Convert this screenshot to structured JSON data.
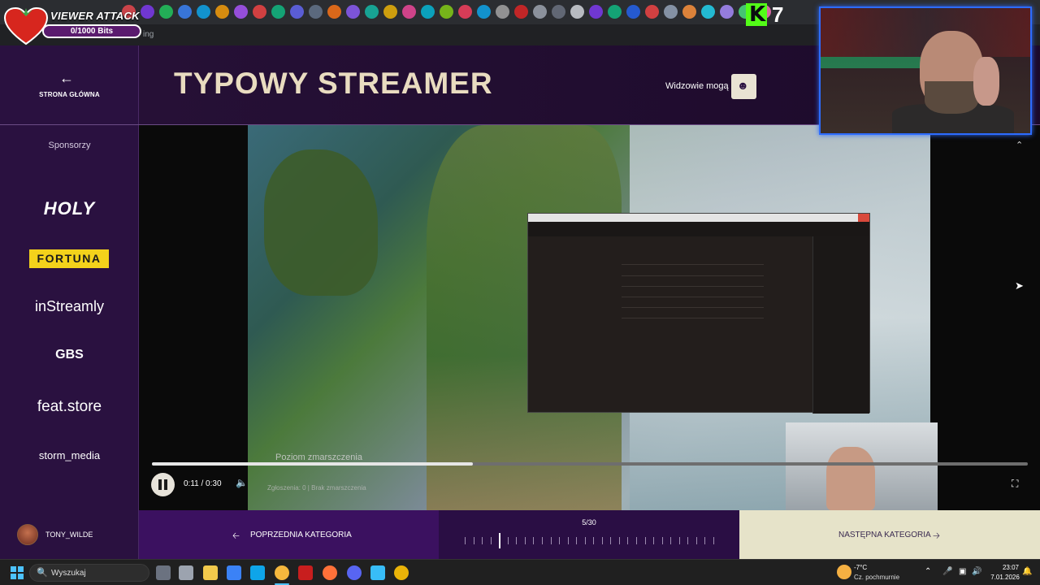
{
  "overlay": {
    "viewer_attack_title": "VIEWER ATTACK",
    "viewer_attack_bits": "0/1000 Bits",
    "kick_count": "7"
  },
  "browser": {
    "address_text": "ing"
  },
  "home": {
    "label": "STRONA GŁÓWNA"
  },
  "header": {
    "title": "TYPOWY STREAMER",
    "viewers_label": "Widzowie mogą"
  },
  "sponsors": {
    "title": "Sponsorzy",
    "items": [
      "HOLY",
      "FORTUNA",
      "inStreamly",
      "GBS",
      "feat.store",
      "storm_media"
    ]
  },
  "video": {
    "subtitle_text": "Poziom zmarszczenia",
    "reports_text": "Zgłoszenia: 0 | Brak zmarszczenia",
    "time": "0:11 / 0:30",
    "progress": 0.3667
  },
  "bottom": {
    "user_name": "TONY_WILDE",
    "prev_label": "POPRZEDNIA KATEGORIA",
    "next_label": "NASTĘPNA KATEGORIA",
    "counter": "5/30",
    "current_index": 5,
    "total": 30
  },
  "taskbar": {
    "search_placeholder": "Wyszukaj",
    "weather_temp": "-7°C",
    "weather_desc": "Cz. pochmurnie",
    "time": "23:07",
    "date": "7.01.2026"
  },
  "colors": {
    "accent_purple": "#3b1160",
    "accent_cream": "#e6e3c9",
    "title_color": "#e9dcc0",
    "webcam_border": "#2d6cff",
    "kick_green": "#53fc18"
  },
  "icons": [
    "back-arrow-icon",
    "users-icon",
    "pause-icon",
    "volume-icon",
    "fullscreen-icon",
    "search-icon",
    "windows-start-icon",
    "heart-icon",
    "kick-icon"
  ]
}
